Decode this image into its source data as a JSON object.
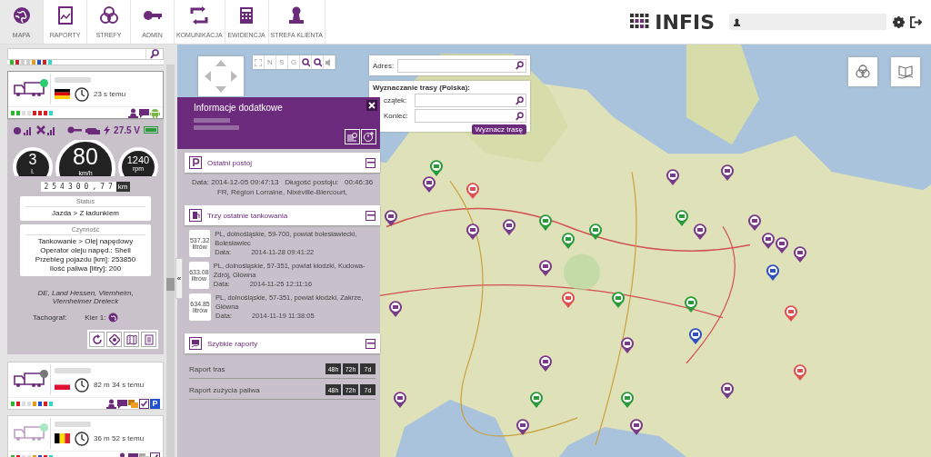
{
  "nav": {
    "items": [
      {
        "label": "MAPA",
        "selected": true
      },
      {
        "label": "RAPORTY",
        "selected": false
      },
      {
        "label": "STREFY",
        "selected": false
      },
      {
        "label": "ADMIN",
        "selected": false
      },
      {
        "label": "KOMUNIKACJA",
        "selected": false
      },
      {
        "label": "EWIDENCJA",
        "selected": false
      },
      {
        "label": "STREFA KLIENTA",
        "selected": false
      }
    ],
    "brand": "INFIS"
  },
  "sidebar": {
    "strip": {
      "indicators": [
        {
          "color": "#2eb82e"
        },
        {
          "color": "#d42020"
        },
        {
          "color": "#cccccc"
        },
        {
          "color": "#cccccc"
        },
        {
          "color": "#e89a1a"
        },
        {
          "color": "#2050d0"
        },
        {
          "color": "#d42020"
        },
        {
          "color": "#30d8c8"
        }
      ]
    },
    "vehicles": [
      {
        "time": "23 s temu",
        "color": "#2ecc71",
        "active": true,
        "expanded": true,
        "indicators": [
          {
            "color": "#2eb82e"
          },
          {
            "color": "#2eb82e"
          },
          {
            "color": "#dddddd"
          },
          {
            "color": "#dddddd"
          },
          {
            "color": "#d42020"
          },
          {
            "color": "#d42020"
          },
          {
            "color": "#d42020"
          },
          {
            "color": "#30d8c8"
          }
        ],
        "icons": [
          {
            "kind": "person"
          },
          {
            "kind": "chat"
          },
          {
            "kind": "android"
          }
        ]
      },
      {
        "time": "82 m 34 s temu",
        "color": "#777777",
        "active": true,
        "expanded": false,
        "indicators": [
          {
            "color": "#2eb82e"
          },
          {
            "color": "#d42020"
          },
          {
            "color": "#dddddd"
          },
          {
            "color": "#dddddd"
          },
          {
            "color": "#e89a1a"
          },
          {
            "color": "#2050d0"
          },
          {
            "color": "#d42020"
          },
          {
            "color": "#30d8c8"
          }
        ],
        "icons": [
          {
            "kind": "person"
          },
          {
            "kind": "chat"
          },
          {
            "kind": "folder"
          },
          {
            "kind": "check"
          },
          {
            "kind": "badge",
            "label": "P"
          }
        ]
      },
      {
        "time": "36 m 52 s temu",
        "color": "#a8e8c0",
        "active": false,
        "expanded": false,
        "indicators": [
          {
            "color": "#2eb82e"
          },
          {
            "color": "#d42020"
          },
          {
            "color": "#dddddd"
          },
          {
            "color": "#dddddd"
          },
          {
            "color": "#e89a1a"
          },
          {
            "color": "#2050d0"
          },
          {
            "color": "#d42020"
          },
          {
            "color": "#30d8c8"
          }
        ],
        "icons": [
          {
            "kind": "person"
          },
          {
            "kind": "chat"
          },
          {
            "kind": "grayfolder"
          },
          {
            "kind": "check"
          }
        ]
      }
    ],
    "details": {
      "voltage": "27.5 V",
      "gauges": [
        {
          "value": "3",
          "unit": "l."
        },
        {
          "value": "80",
          "unit": "km/h"
        },
        {
          "value": "1240",
          "unit": "rpm"
        }
      ],
      "odometer": "254300,77",
      "odometer_unit": "km",
      "status_title": "Status",
      "status": "Jazda > Z ładunkiem",
      "activity_title": "Czynność",
      "activity": [
        "Tankowanie > Olej napędowy",
        "Operator oleju napęd.: Shell",
        "Przebieg pojazdu [km]: 253850",
        "Ilość paliwa [litry]: 200"
      ],
      "location": "DE, Land Hessen, Viernheim, Viernheimer Dreieck",
      "tacho_label": "Tachograf:",
      "driver_label": "Kier 1:"
    },
    "collapse": "«"
  },
  "map": {
    "toolbar": [
      "N",
      "S",
      "G"
    ],
    "address_label": "Adres:",
    "route_title": "Wyznaczanie trasy (Polska):",
    "route_start": "czątek:",
    "route_end": "Koniec:",
    "route_button": "Wyznacz trasę",
    "markers": [
      {
        "color": "#2a9a3a"
      },
      {
        "color": "#7a3a8a"
      },
      {
        "color": "#7a3a8a"
      },
      {
        "color": "#7a3a8a"
      },
      {
        "color": "#7a3a8a"
      },
      {
        "color": "#2a9a3a"
      },
      {
        "color": "#2a9a3a"
      },
      {
        "color": "#2a9a3a"
      },
      {
        "color": "#7a3a8a"
      },
      {
        "color": "#e05050"
      },
      {
        "color": "#2a9a3a"
      },
      {
        "color": "#7a3a8a"
      },
      {
        "color": "#2a9a3a"
      },
      {
        "color": "#7a3a8a"
      },
      {
        "color": "#7a3a8a"
      },
      {
        "color": "#7a3a8a"
      },
      {
        "color": "#7a3a8a"
      },
      {
        "color": "#7a3a8a"
      },
      {
        "color": "#7a3a8a"
      },
      {
        "color": "#e05050"
      },
      {
        "color": "#3050c0"
      },
      {
        "color": "#2a9a3a"
      },
      {
        "color": "#7a3a8a"
      },
      {
        "color": "#7a3a8a"
      },
      {
        "color": "#7a3a8a"
      },
      {
        "color": "#7a3a8a"
      },
      {
        "color": "#2a9a3a"
      },
      {
        "color": "#3050c0"
      },
      {
        "color": "#7a3a8a"
      },
      {
        "color": "#7a3a8a"
      },
      {
        "color": "#e05050"
      },
      {
        "color": "#e05050"
      },
      {
        "color": "#2a9a3a"
      },
      {
        "color": "#7a3a8a"
      }
    ]
  },
  "info": {
    "title": "Informacje dodatkowe",
    "stop": {
      "title": "Ostatni postój",
      "date": "Data: 2014-12-05 09:47:13",
      "duration_label": "Długość postoju:",
      "duration": "00:46:36",
      "address": "FR, Région Lorraine, Nixéville-Blercourt,"
    },
    "fuel": {
      "title": "Trzy ostatnie tankowania",
      "entries": [
        {
          "amount": "537.32",
          "unit": "litrów",
          "address": "PL, dolnośląskie, 59-700, powiat bolesławiecki, Bolesławiec",
          "date_label": "Data:",
          "date": "2014-11-28 09:41:22"
        },
        {
          "amount": "633.08",
          "unit": "litrów",
          "address": "PL, dolnośląskie, 57-351, powiat kłodzki, Kudowa-Zdrój, Główna",
          "date_label": "Data:",
          "date": "2014-11-25 12:11:16"
        },
        {
          "amount": "634.85",
          "unit": "litrów",
          "address": "PL, dolnośląskie, 57-351, powiat kłodzki, Zakrze, Główna",
          "date_label": "Data:",
          "date": "2014-11-19 11:38:05"
        }
      ]
    },
    "reports": {
      "title": "Szybkie raporty",
      "rows": [
        {
          "label": "Raport tras",
          "buttons": [
            "48h",
            "72h",
            "7d"
          ]
        },
        {
          "label": "Raport zużycia paliwa",
          "buttons": [
            "48h",
            "72h",
            "7d"
          ]
        }
      ]
    }
  }
}
